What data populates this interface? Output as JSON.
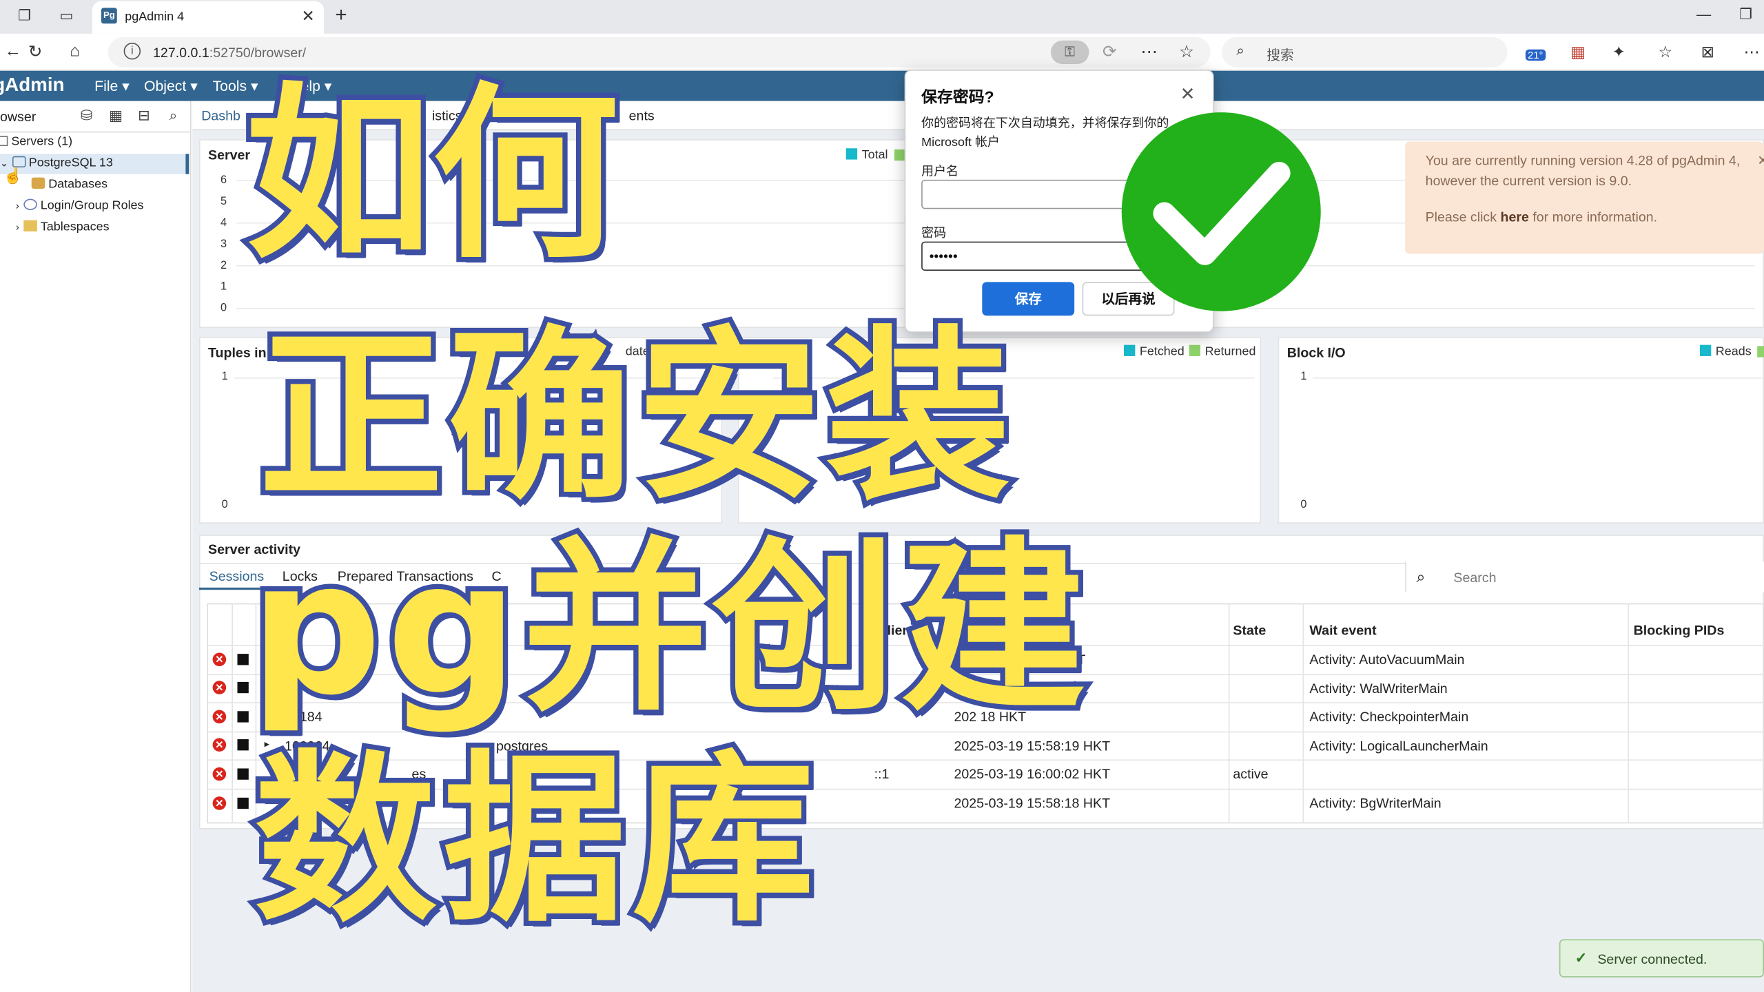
{
  "browser": {
    "tab_title": "pgAdmin 4",
    "favicon_text": "Pg",
    "url_host": "127.0.0.1",
    "url_rest": ":52750/browser/",
    "search_placeholder": "搜索",
    "weather_badge": "21°"
  },
  "pgadmin": {
    "logo": "gAdmin",
    "menus": [
      "File",
      "Object",
      "Tools",
      "Help"
    ],
    "browser_title": "owser",
    "tree": {
      "servers": "Servers (1)",
      "server": "PostgreSQL 13",
      "databases": "Databases",
      "roles": "Login/Group Roles",
      "tablespaces": "Tablespaces"
    },
    "main_tabs": [
      "Dashb",
      "istics",
      "ents"
    ],
    "cards": {
      "server_sessions": {
        "title": "Server",
        "legend": [
          "Total"
        ],
        "y_ticks": [
          "6",
          "5",
          "4",
          "3",
          "2",
          "1",
          "0"
        ]
      },
      "tuples_in": {
        "title": "Tuples in",
        "legend": [
          "Ins",
          "dates",
          "Del"
        ],
        "y_ticks": [
          "1",
          "0"
        ]
      },
      "tuples_out": {
        "title": "T",
        "legend": [
          "Fetched",
          "Returned"
        ]
      },
      "block_io": {
        "title": "Block I/O",
        "legend": [
          "Reads"
        ],
        "y_ticks": [
          "1",
          "0"
        ]
      }
    },
    "update_notice": {
      "line1": "You are currently running version 4.28 of pgAdmin 4,",
      "line2": "however the current version is 9.0.",
      "line3_pre": "Please click ",
      "line3_link": "here",
      "line3_post": " for more information."
    },
    "server_activity": {
      "title": "Server activity",
      "tabs": [
        "Sessions",
        "Locks",
        "Prepared Transactions",
        "C"
      ],
      "search_placeholder": "Search",
      "columns": [
        "U",
        "plication",
        "Client",
        "State",
        "Wait event",
        "Blocking PIDs"
      ],
      "rows": [
        {
          "pid": "",
          "user": "",
          "app": "",
          "client": "",
          "start": "HKT",
          "state": "",
          "wait": "Activity: AutoVacuumMain"
        },
        {
          "pid": "",
          "user": "",
          "app": "",
          "client": "",
          "start": "HKT",
          "state": "",
          "wait": "Activity: WalWriterMain"
        },
        {
          "pid": "02184",
          "user": "",
          "app": "",
          "client": "",
          "start": "202 18 HKT",
          "state": "",
          "wait": "Activity: CheckpointerMain"
        },
        {
          "pid": "103064",
          "user": "",
          "app": "postgres",
          "client": "",
          "start": "2025-03-19 15:58:19 HKT",
          "state": "",
          "wait": "Activity: LogicalLauncherMain"
        },
        {
          "pid": "",
          "user": "es",
          "app": "gres",
          "client": "4 - DB:postgre",
          "client2": "::1",
          "start": "2025-03-19 16:00:02 HKT",
          "state": "active",
          "wait": ""
        },
        {
          "pid": "",
          "user": "",
          "app": "",
          "client": "",
          "start": "2025-03-19 15:58:18 HKT",
          "state": "",
          "wait": "Activity: BgWriterMain"
        }
      ]
    },
    "toast": "Server connected."
  },
  "dialog": {
    "title": "保存密码?",
    "desc_line1": "你的密码将在下次自动填充，并将保存到你的",
    "desc_line2": "Microsoft 帐户",
    "username_label": "用户名",
    "username_value": "",
    "password_label": "密码",
    "password_value": "••••••",
    "save_label": "保存",
    "later_label": "以后再说"
  },
  "overlay_title": {
    "line1": "如何",
    "line2": "正确安装",
    "line3": "pg并创建",
    "line4": "数据库"
  },
  "colors": {
    "pg_blue": "#326690",
    "overlay_fill": "#ffe64d",
    "overlay_stroke": "#3d4fa3",
    "check_green": "#22b11a",
    "save_blue": "#1e6fd9"
  }
}
